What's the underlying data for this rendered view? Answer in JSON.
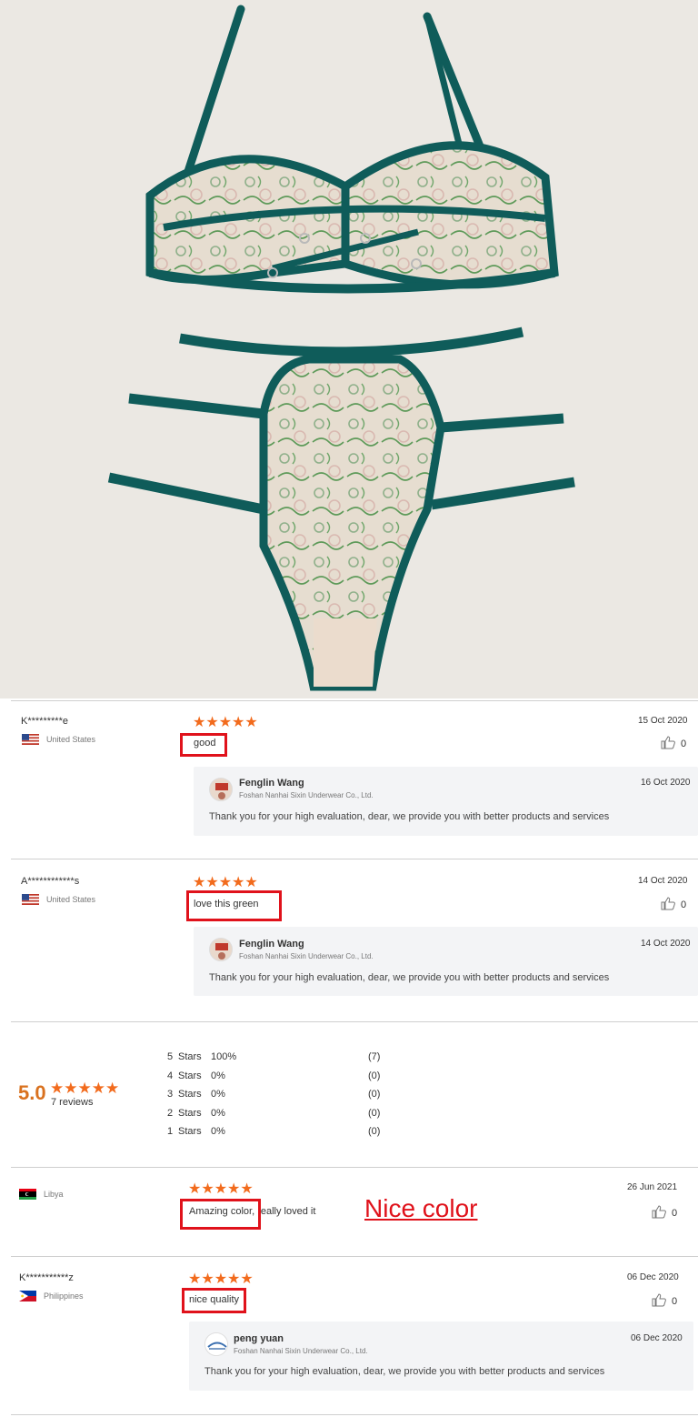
{
  "reviews_top": [
    {
      "reviewer": "K*********e",
      "country": "United States",
      "stars": "★★★★★",
      "date": "15 Oct 2020",
      "text": "good",
      "likes": "0",
      "reply": {
        "name": "Fenglin Wang",
        "company": "Foshan Nanhai Sixin Underwear Co., Ltd.",
        "date": "16 Oct 2020",
        "text": "Thank you for your high evaluation, dear, we provide you with better products and services"
      }
    },
    {
      "reviewer": "A************s",
      "country": "United States",
      "stars": "★★★★★",
      "date": "14 Oct 2020",
      "text": "love this green",
      "likes": "0",
      "reply": {
        "name": "Fenglin Wang",
        "company": "Foshan Nanhai Sixin Underwear Co., Ltd.",
        "date": "14 Oct 2020",
        "text": "Thank you for your high evaluation, dear, we provide you with better products and services"
      }
    }
  ],
  "summary": {
    "score": "5.0",
    "stars": "★★★★★",
    "count": "7 reviews",
    "distribution": [
      {
        "label": "5",
        "unit": "Stars",
        "pct": "100%",
        "count": "(7)"
      },
      {
        "label": "4",
        "unit": "Stars",
        "pct": "0%",
        "count": "(0)"
      },
      {
        "label": "3",
        "unit": "Stars",
        "pct": "0%",
        "count": "(0)"
      },
      {
        "label": "2",
        "unit": "Stars",
        "pct": "0%",
        "count": "(0)"
      },
      {
        "label": "1",
        "unit": "Stars",
        "pct": "0%",
        "count": "(0)"
      }
    ]
  },
  "reviews_bottom": [
    {
      "reviewer": "",
      "country": "Libya",
      "stars": "★★★★★",
      "date": "26 Jun 2021",
      "text": "Amazing color, really loved it",
      "likes": "0",
      "annotation": "Nice color"
    },
    {
      "reviewer": "K***********z",
      "country": "Philippines",
      "stars": "★★★★★",
      "date": "06 Dec 2020",
      "text": "nice quality",
      "likes": "0",
      "reply": {
        "name": "peng yuan",
        "company": "Foshan Nanhai Sixin Underwear Co., Ltd.",
        "date": "06 Dec 2020",
        "text": "Thank you for your high evaluation, dear, we provide you with better products and services"
      }
    }
  ],
  "icons": {
    "like": "thumbs-up-icon",
    "flags": [
      "us-flag-icon",
      "libya-flag-icon",
      "philippines-flag-icon"
    ]
  },
  "colors": {
    "star": "#f26b1d",
    "highlight": "#e0121b",
    "score": "#d9711f",
    "reply_bg": "#f3f4f6",
    "product_bg": "#ebe8e3",
    "lingerie_trim": "#0f5c5a"
  }
}
